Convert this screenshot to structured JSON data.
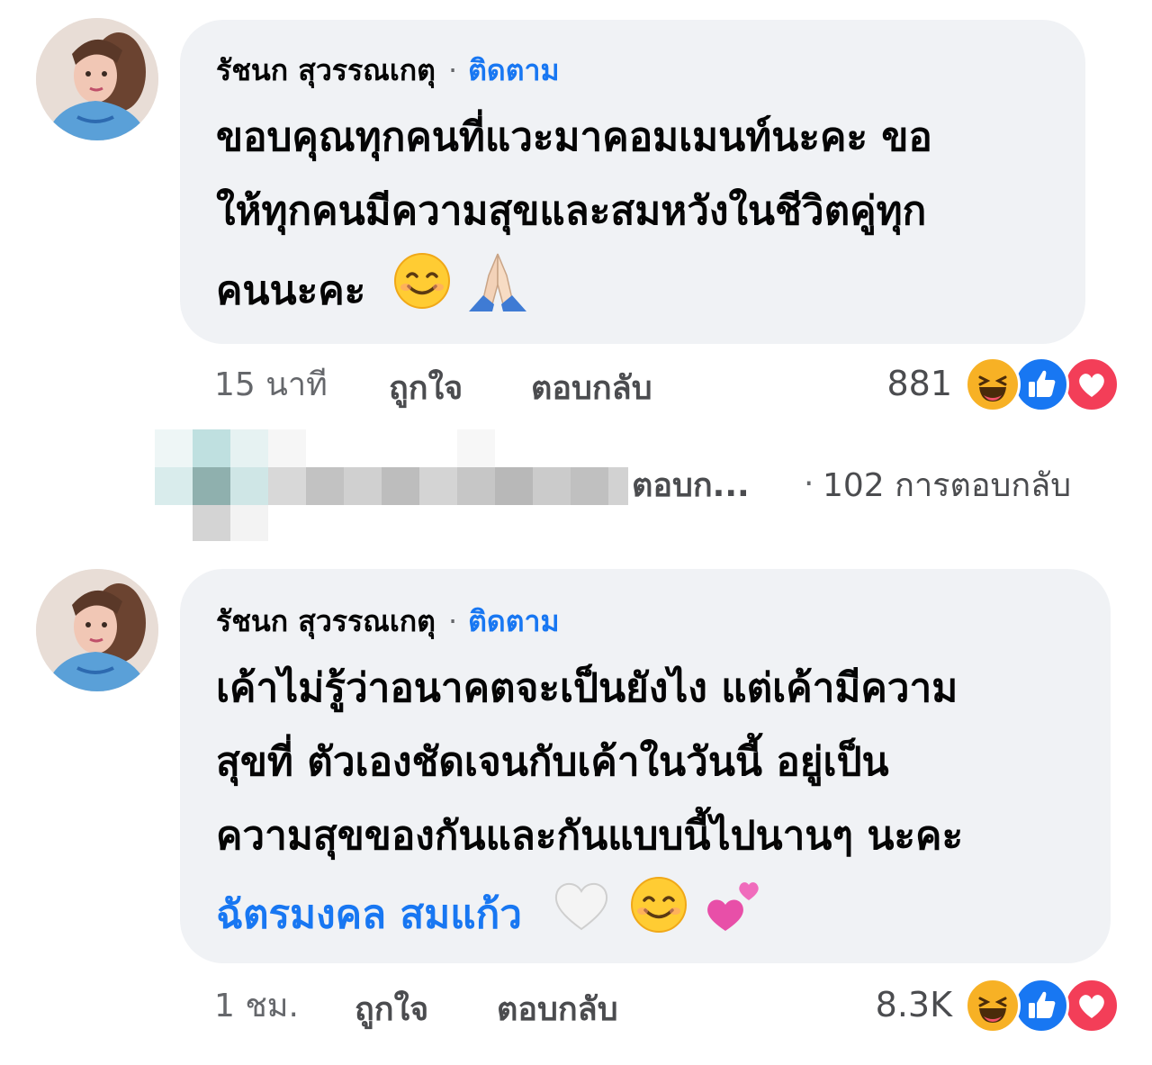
{
  "comments": [
    {
      "author": "รัชนก สุวรรณเกตุ",
      "follow_label": "ติดตาม",
      "separator": "·",
      "lines": [
        "ขอบคุณทุกคนที่แวะมาคอมเมนท์นะคะ ขอ",
        "ให้ทุกคนมีความสุขและสมหวังในชีวิตคู่ทุก",
        "คนนะคะ"
      ],
      "emojis": [
        "smiling-face-emoji",
        "folded-hands-emoji"
      ],
      "time": "15 นาที",
      "like_label": "ถูกใจ",
      "reply_label": "ตอบกลับ",
      "reaction_count": "881",
      "reactions": [
        "haha-icon",
        "like-icon",
        "love-icon"
      ]
    },
    {
      "author": "รัชนก สุวรรณเกตุ",
      "follow_label": "ติดตาม",
      "separator": "·",
      "lines": [
        "เค้าไม่รู้ว่าอนาคตจะเป็นยังไง แต่เค้ามีความ",
        "สุขที่ ตัวเองชัดเจนกับเค้าในวันนี้ อยู่เป็น",
        "ความสุขของกันและกันแบบนี้ไปนานๆ นะคะ"
      ],
      "mention": "ฉัตรมงคล สมแก้ว",
      "emojis": [
        "white-heart-emoji",
        "smiling-face-emoji",
        "two-hearts-emoji"
      ],
      "time": "1 ชม.",
      "like_label": "ถูกใจ",
      "reply_label": "ตอบกลับ",
      "reaction_count": "8.3K",
      "reactions": [
        "haha-icon",
        "like-icon",
        "love-icon"
      ]
    }
  ],
  "replies_row": {
    "preview": "ตอบก...",
    "separator": "·",
    "count_label": "102 การตอบกลับ"
  },
  "colors": {
    "accent": "#1877f2",
    "bubble": "#f0f2f5",
    "meta": "#65676b",
    "love": "#f33e58",
    "haha": "#f7b125"
  }
}
